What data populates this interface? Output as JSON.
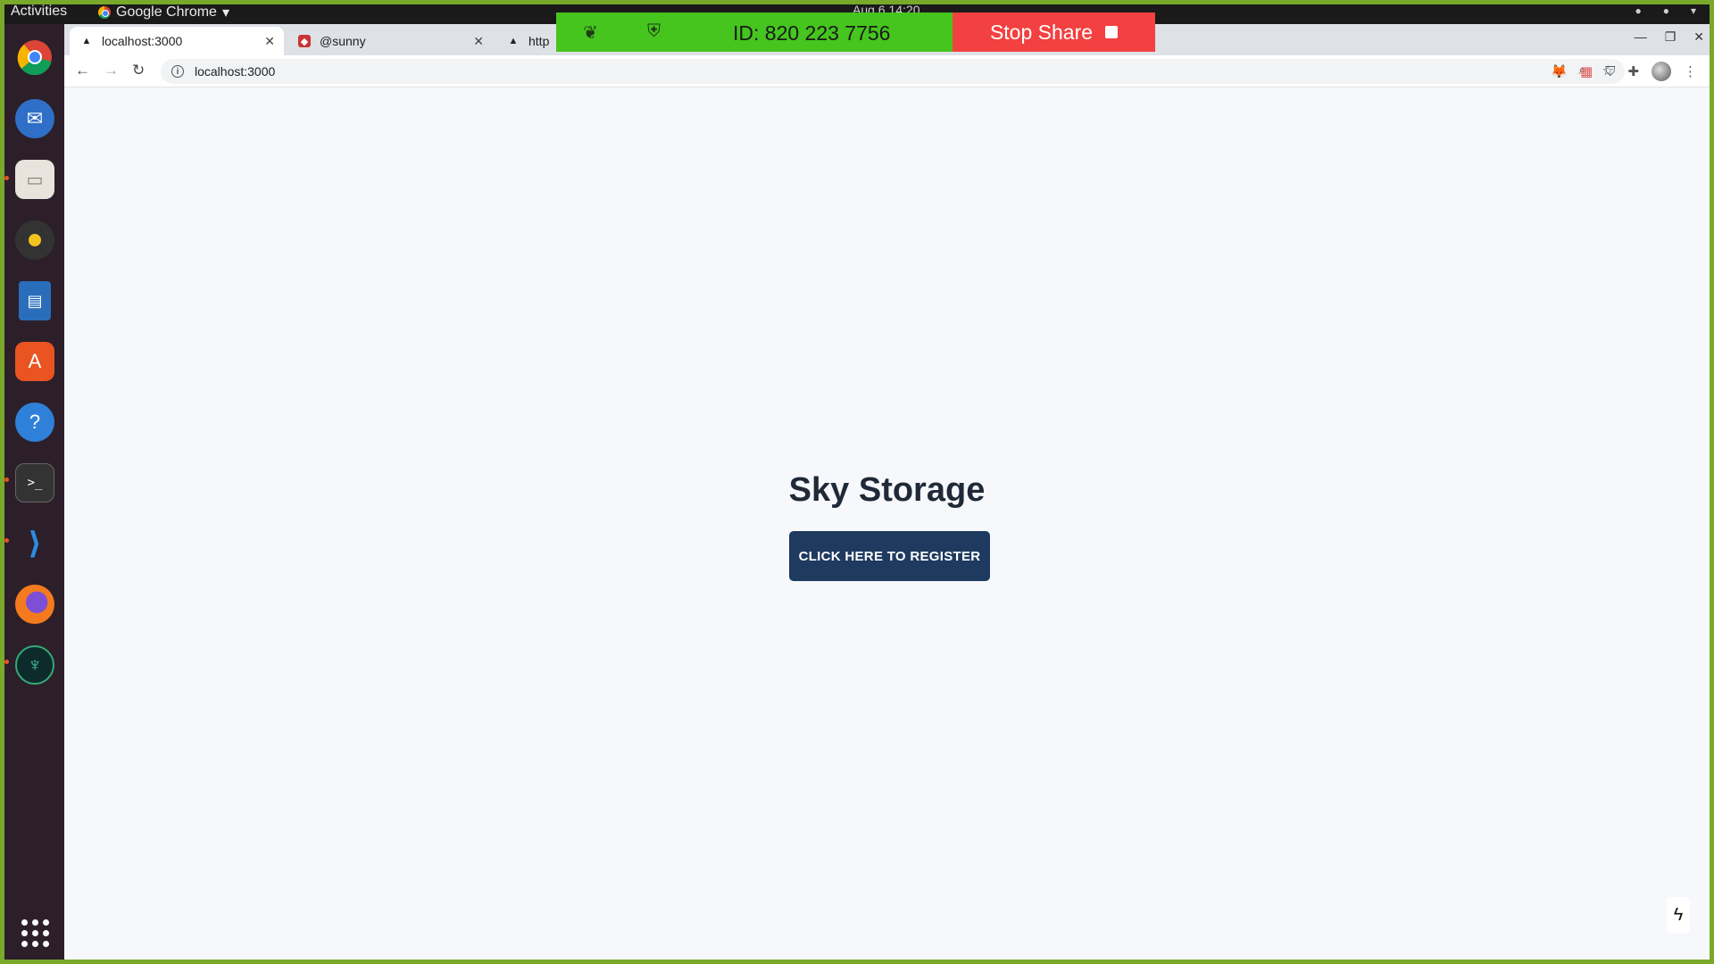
{
  "topbar": {
    "activities": "Activities",
    "app_name": "Google Chrome",
    "clock": "Aug 6  14:20"
  },
  "dock": {
    "items": [
      "chrome-icon",
      "thunderbird-icon",
      "files-icon",
      "rhythmbox-icon",
      "writer-icon",
      "software-icon",
      "help-icon",
      "terminal-icon",
      "vscode-icon",
      "firefox-icon",
      "gitkraken-icon"
    ],
    "show_apps": "show-apps-icon"
  },
  "browser": {
    "tabs": [
      {
        "label": "localhost:3000",
        "active": true
      },
      {
        "label": "@sunny",
        "active": false
      },
      {
        "label": "http",
        "active": false
      }
    ],
    "url": "localhost:3000"
  },
  "page": {
    "title": "Sky Storage",
    "register_label": "CLICK HERE TO REGISTER"
  },
  "share": {
    "meeting_id": "ID: 820 223 7756",
    "stop_label": "Stop Share"
  },
  "colors": {
    "share_green": "#45c51e",
    "stop_red": "#f34040",
    "button_navy": "#1e3a5f",
    "page_bg": "#f6f8fb"
  }
}
